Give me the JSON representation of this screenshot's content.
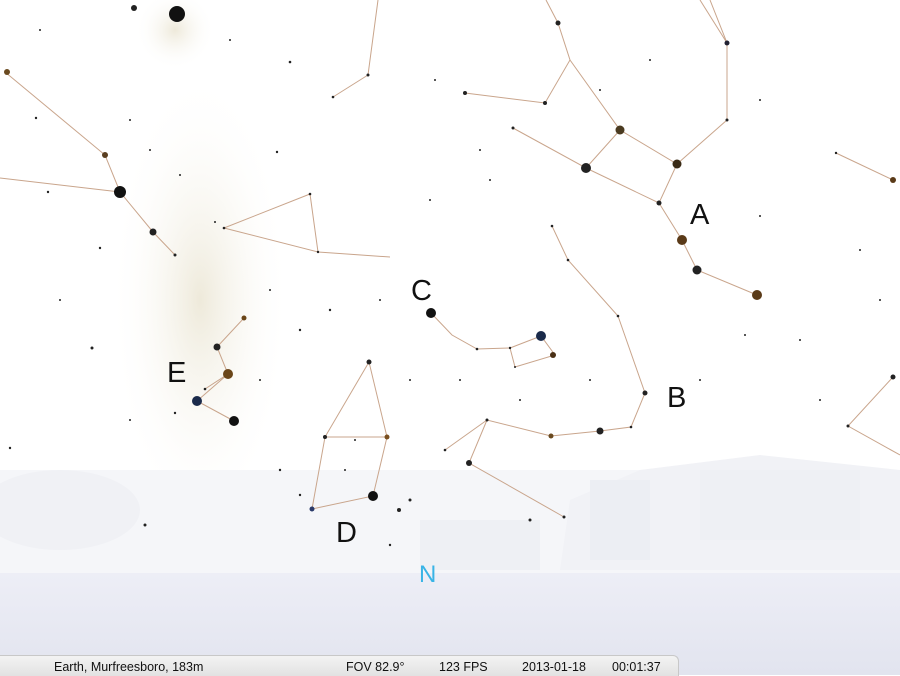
{
  "markers": [
    "A",
    "B",
    "C",
    "D",
    "E"
  ],
  "cardinal": {
    "north": "N",
    "color": "#39b4e6"
  },
  "status_bar": {
    "location": "Earth, Murfreesboro, 183m",
    "fov": "FOV 82.9°",
    "fps": "123 FPS",
    "date": "2013-01-18",
    "time": "00:01:37"
  },
  "colors": {
    "constellation_line": "#c9a58c",
    "sky": "#ffffff",
    "ground": "#e9ebf5"
  }
}
